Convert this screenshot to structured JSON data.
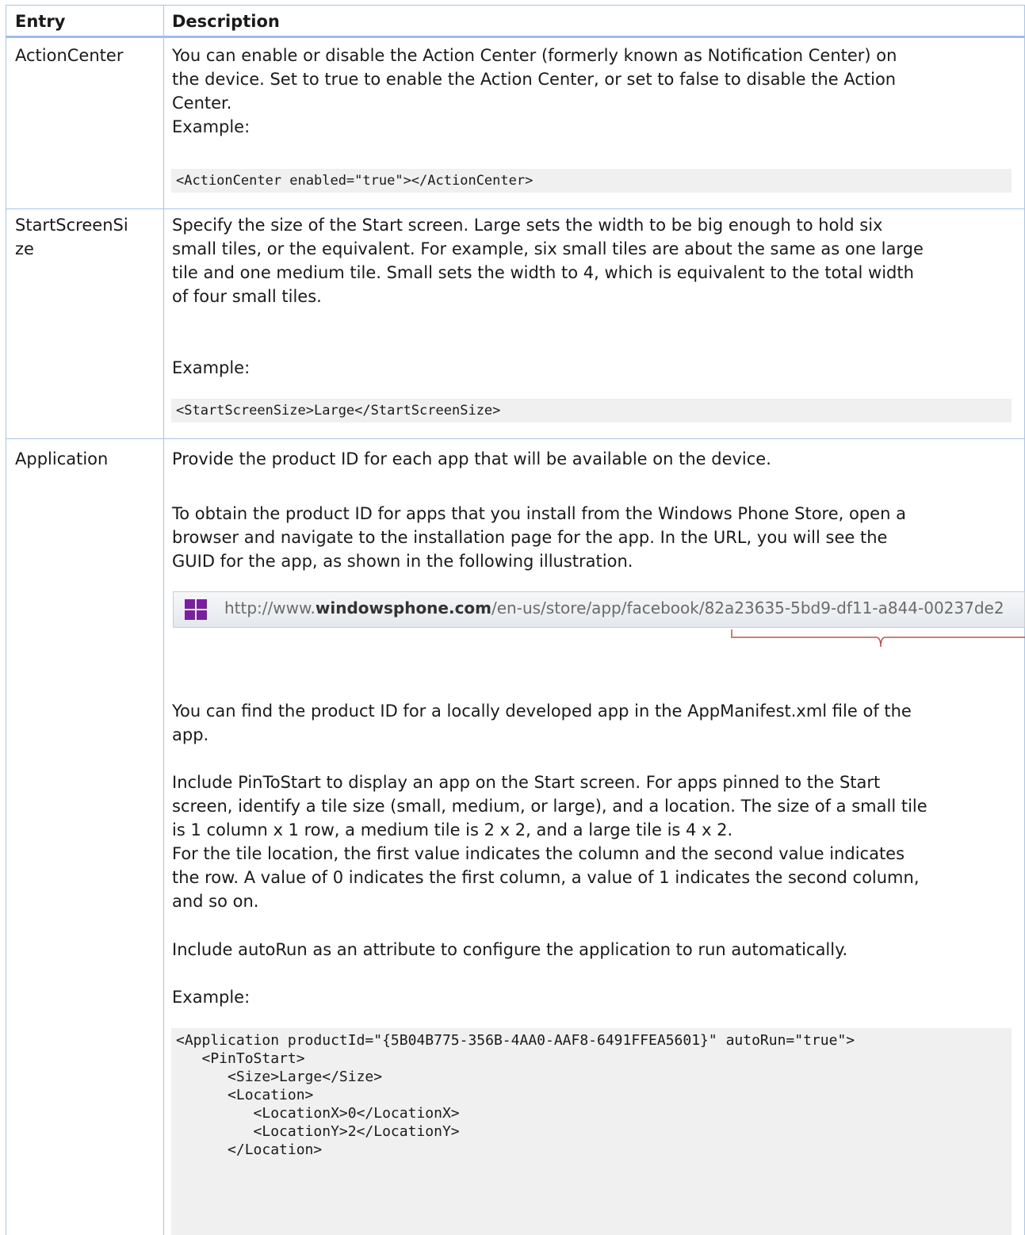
{
  "header": {
    "entry": "Entry",
    "description": "Description"
  },
  "rows": [
    {
      "entry": "ActionCenter",
      "text": "You can enable or disable the Action Center (formerly known as Notification Center) on\nthe device. Set to true to enable the Action Center, or set to false to disable the Action\nCenter.\nExample:",
      "code": "<ActionCenter enabled=\"true\"></ActionCenter>"
    },
    {
      "entry": "StartScreenSi\nze",
      "text": "Specify the size of the Start screen. Large sets the width to be big enough to hold six\nsmall tiles, or the equivalent. For example, six small tiles are about the same as one large\ntile and one medium tile. Small sets the width to 4, which is equivalent to the total width\nof four small tiles.",
      "example": "Example:",
      "code": "<StartScreenSize>Large</StartScreenSize>"
    },
    {
      "entry": "Application",
      "p1": "Provide the product ID for each app that will be available on the device.",
      "p2": "To obtain the product ID for apps that you install from the Windows Phone Store, open a\nbrowser and navigate to the installation page for the app. In the URL, you will see the\nGUID for the app, as shown in the following illustration.",
      "illustration": {
        "url_pre": "http://www.",
        "url_bold": "windowsphone.com",
        "url_post": "/en-us/store/app/facebook/82a23635-5bd9-df11-a844-00237de2"
      },
      "p3": "You can find the product ID for a locally developed app in the AppManifest.xml file of the\napp.",
      "p4": "Include PinToStart to display an app on the Start screen. For apps pinned to the Start\nscreen, identify a tile size (small, medium, or large), and a location. The size of a small tile\nis 1 column x 1 row, a medium tile is 2 x 2, and a large tile is 4 x 2.\nFor the tile location, the first value indicates the column and the second value indicates\nthe row. A value of 0 indicates the first column, a value of 1 indicates the second column,\nand so on.",
      "p5": "Include autoRun as an attribute to configure the application to run automatically.",
      "example": "Example:",
      "code": "<Application productId=\"{5B04B775-356B-4AA0-AAF8-6491FFEA5601}\" autoRun=\"true\">\n   <PinToStart>\n      <Size>Large</Size>\n      <Location>\n         <LocationX>0</LocationX>\n         <LocationY>2</LocationY>\n      </Location>"
    }
  ],
  "colors": {
    "border": "#a9c4e6",
    "code_bg": "#f0f0f0",
    "bracket": "#c0504d"
  }
}
